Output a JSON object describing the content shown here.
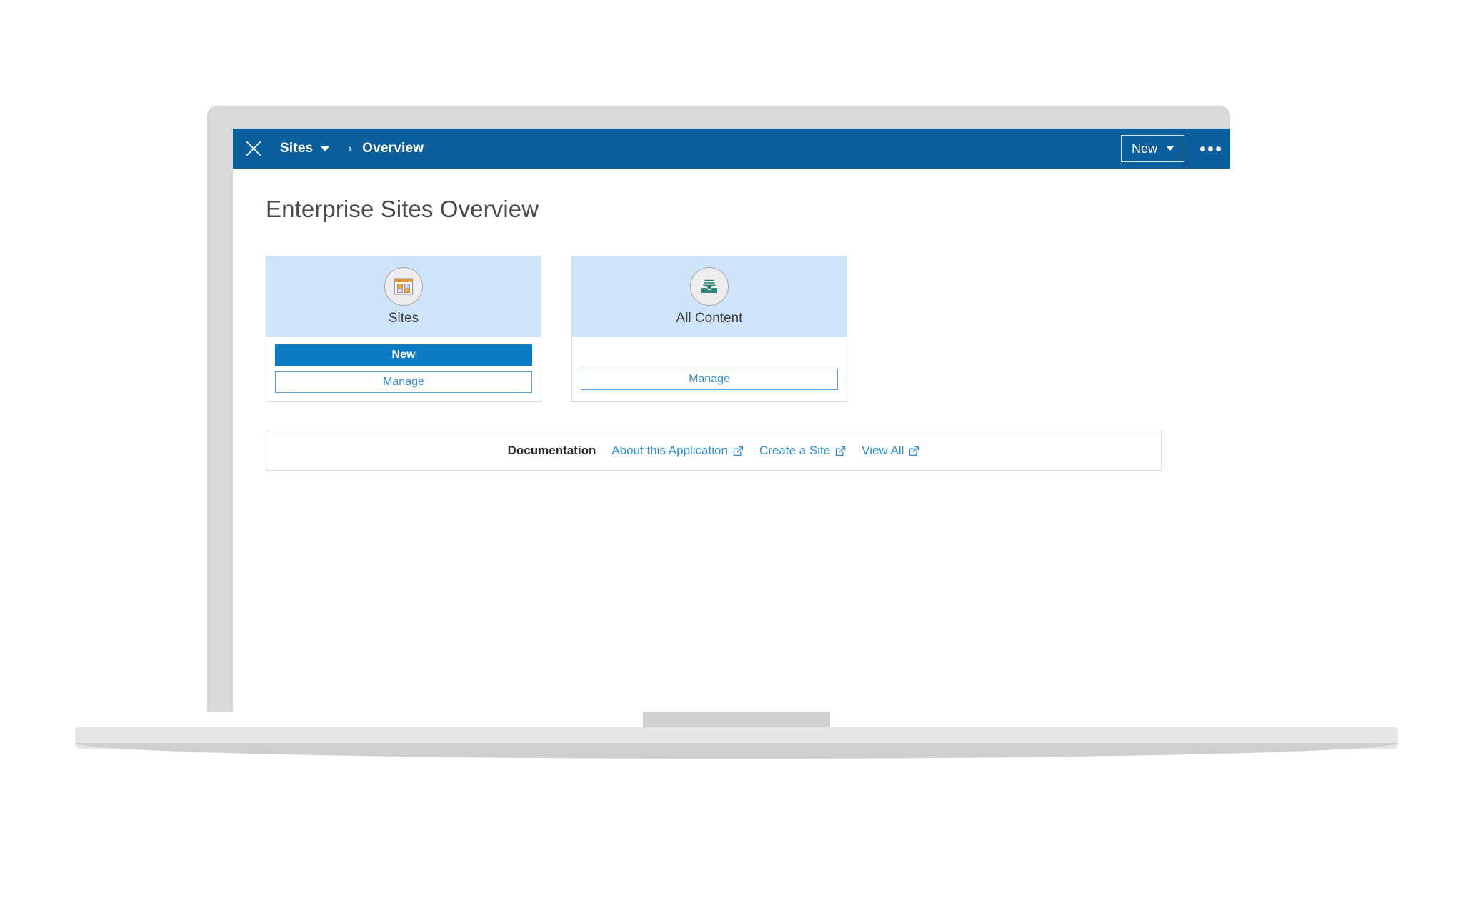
{
  "window": {
    "device": "laptop-mockup"
  },
  "header": {
    "close_icon": "close-icon",
    "breadcrumb": {
      "root_label": "Sites",
      "separator": "›",
      "current_label": "Overview"
    },
    "new_button_label": "New",
    "new_button_caret_icon": "chevron-down-icon",
    "overflow_icon": "ellipsis-icon",
    "background_color": "#0b5f9c"
  },
  "page": {
    "title": "Enterprise Sites Overview"
  },
  "cards": [
    {
      "title": "Sites",
      "icon": "sites-grid-icon",
      "header_color": "#cee4f8",
      "buttons": [
        {
          "label": "New",
          "style": "primary"
        },
        {
          "label": "Manage",
          "style": "outline"
        }
      ]
    },
    {
      "title": "All Content",
      "icon": "inbox-tray-icon",
      "header_color": "#cee4f8",
      "buttons": [
        {
          "label": "Manage",
          "style": "outline"
        }
      ]
    }
  ],
  "documentation": {
    "label": "Documentation",
    "links": [
      {
        "label": "About this Application",
        "icon": "external-link-icon"
      },
      {
        "label": "Create a Site",
        "icon": "external-link-icon"
      },
      {
        "label": "View All",
        "icon": "external-link-icon"
      }
    ],
    "link_color": "#2e8fd8"
  }
}
